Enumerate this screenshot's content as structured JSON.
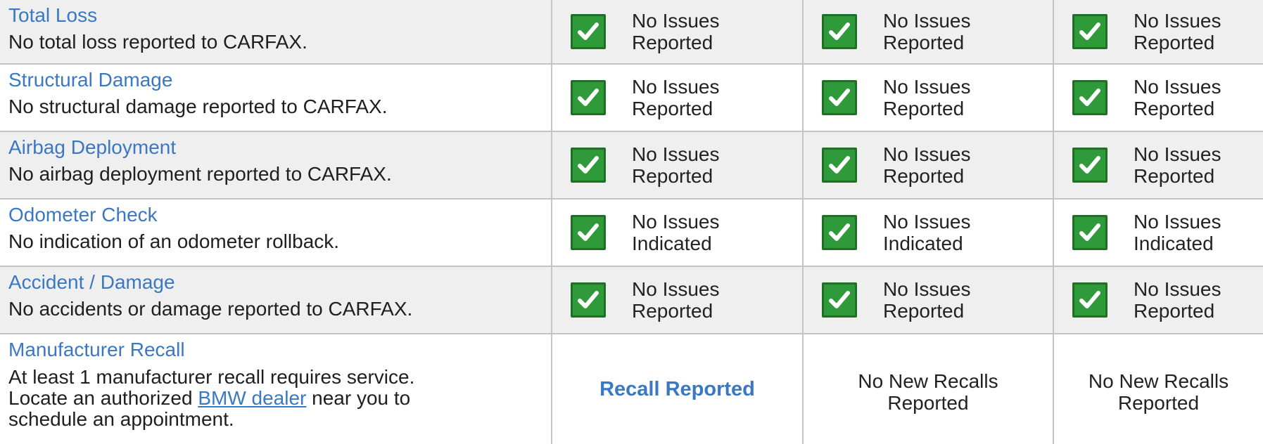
{
  "rows": [
    {
      "title": "Total Loss",
      "description": "No total loss reported to CARFAX.",
      "results": [
        {
          "line1": "No Issues",
          "line2": "Reported"
        },
        {
          "line1": "No Issues",
          "line2": "Reported"
        },
        {
          "line1": "No Issues",
          "line2": "Reported"
        }
      ]
    },
    {
      "title": "Structural Damage",
      "description": "No structural damage reported to CARFAX.",
      "results": [
        {
          "line1": "No Issues",
          "line2": "Reported"
        },
        {
          "line1": "No Issues",
          "line2": "Reported"
        },
        {
          "line1": "No Issues",
          "line2": "Reported"
        }
      ]
    },
    {
      "title": "Airbag Deployment",
      "description": "No airbag deployment reported to CARFAX.",
      "results": [
        {
          "line1": "No Issues",
          "line2": "Reported"
        },
        {
          "line1": "No Issues",
          "line2": "Reported"
        },
        {
          "line1": "No Issues",
          "line2": "Reported"
        }
      ]
    },
    {
      "title": "Odometer Check",
      "description": "No indication of an odometer rollback.",
      "results": [
        {
          "line1": "No Issues",
          "line2": "Indicated"
        },
        {
          "line1": "No Issues",
          "line2": "Indicated"
        },
        {
          "line1": "No Issues",
          "line2": "Indicated"
        }
      ]
    },
    {
      "title": "Accident / Damage",
      "description": "No accidents or damage reported to CARFAX.",
      "results": [
        {
          "line1": "No Issues",
          "line2": "Reported"
        },
        {
          "line1": "No Issues",
          "line2": "Reported"
        },
        {
          "line1": "No Issues",
          "line2": "Reported"
        }
      ]
    }
  ],
  "recall": {
    "title": "Manufacturer Recall",
    "description_line1": "At least 1 manufacturer recall requires service.",
    "description_pre_link": "Locate an authorized ",
    "dealer_link": "BMW dealer",
    "description_post_link": " near you to",
    "description_line3": "schedule an appointment.",
    "col1": "Recall Reported",
    "col2": {
      "line1": "No New Recalls",
      "line2": "Reported"
    },
    "col3": {
      "line1": "No New Recalls",
      "line2": "Reported"
    }
  },
  "colors": {
    "link": "#3a78c2",
    "check_green": "#2f9a3a",
    "row_shade": "#efefef",
    "divider": "#c4c4c4"
  },
  "icons": {
    "status": "green-check-icon"
  }
}
